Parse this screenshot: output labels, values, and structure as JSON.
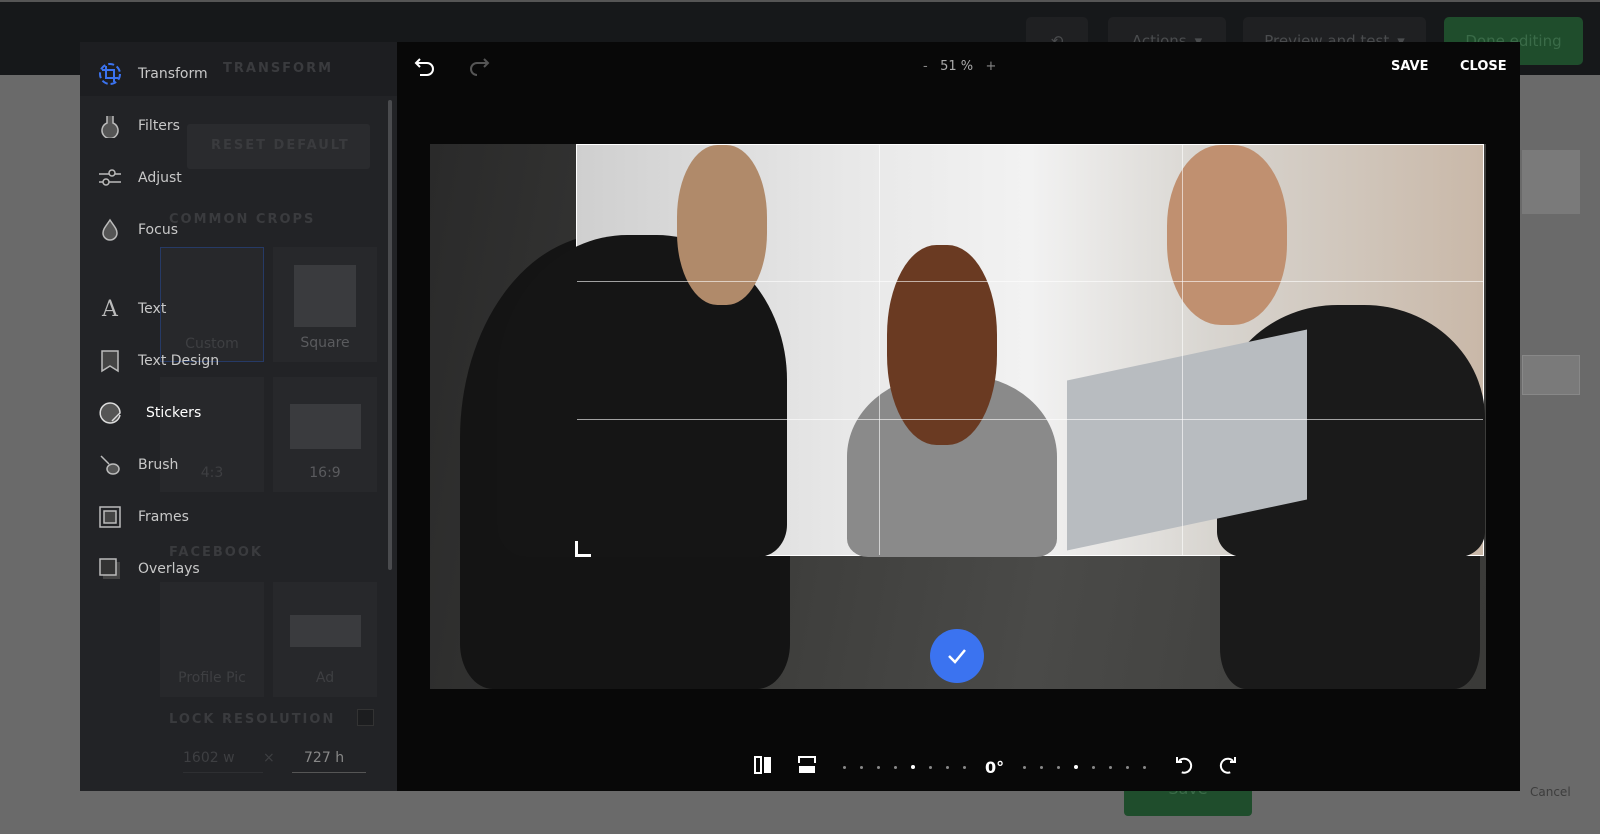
{
  "background": {
    "actions_label": "Actions",
    "preview_label": "Preview and test",
    "done_label": "Done editing",
    "save_label": "Save",
    "cancel_label": "Cancel"
  },
  "editor": {
    "zoom": {
      "minus": "-",
      "value": "51 %",
      "plus": "+"
    },
    "save_label": "SAVE",
    "close_label": "CLOSE",
    "tools": [
      {
        "label": "Transform",
        "icon": "crop-icon",
        "active": true
      },
      {
        "label": "Filters",
        "icon": "flask-icon"
      },
      {
        "label": "Adjust",
        "icon": "sliders-icon"
      },
      {
        "label": "Focus",
        "icon": "drop-icon"
      },
      {
        "label": "Text",
        "icon": "text-icon"
      },
      {
        "label": "Text Design",
        "icon": "bookmark-text-icon"
      },
      {
        "label": "Stickers",
        "icon": "sticker-icon"
      },
      {
        "label": "Brush",
        "icon": "brush-icon"
      },
      {
        "label": "Frames",
        "icon": "frame-icon"
      },
      {
        "label": "Overlays",
        "icon": "overlay-icon"
      }
    ],
    "panel": {
      "title": "TRANSFORM",
      "reset": "RESET DEFAULT",
      "common_crops": "COMMON CROPS",
      "crops": [
        "Custom",
        "Square",
        "4:3",
        "16:9"
      ],
      "facebook": "FACEBOOK",
      "fb_crops": [
        "Profile Pic",
        "Ad"
      ],
      "lock_resolution": "LOCK RESOLUTION",
      "width": "1602",
      "w_unit": "w",
      "times": "×",
      "height": "727",
      "h_unit": "h"
    },
    "angle": "0°",
    "accent": "#3b73f0"
  }
}
